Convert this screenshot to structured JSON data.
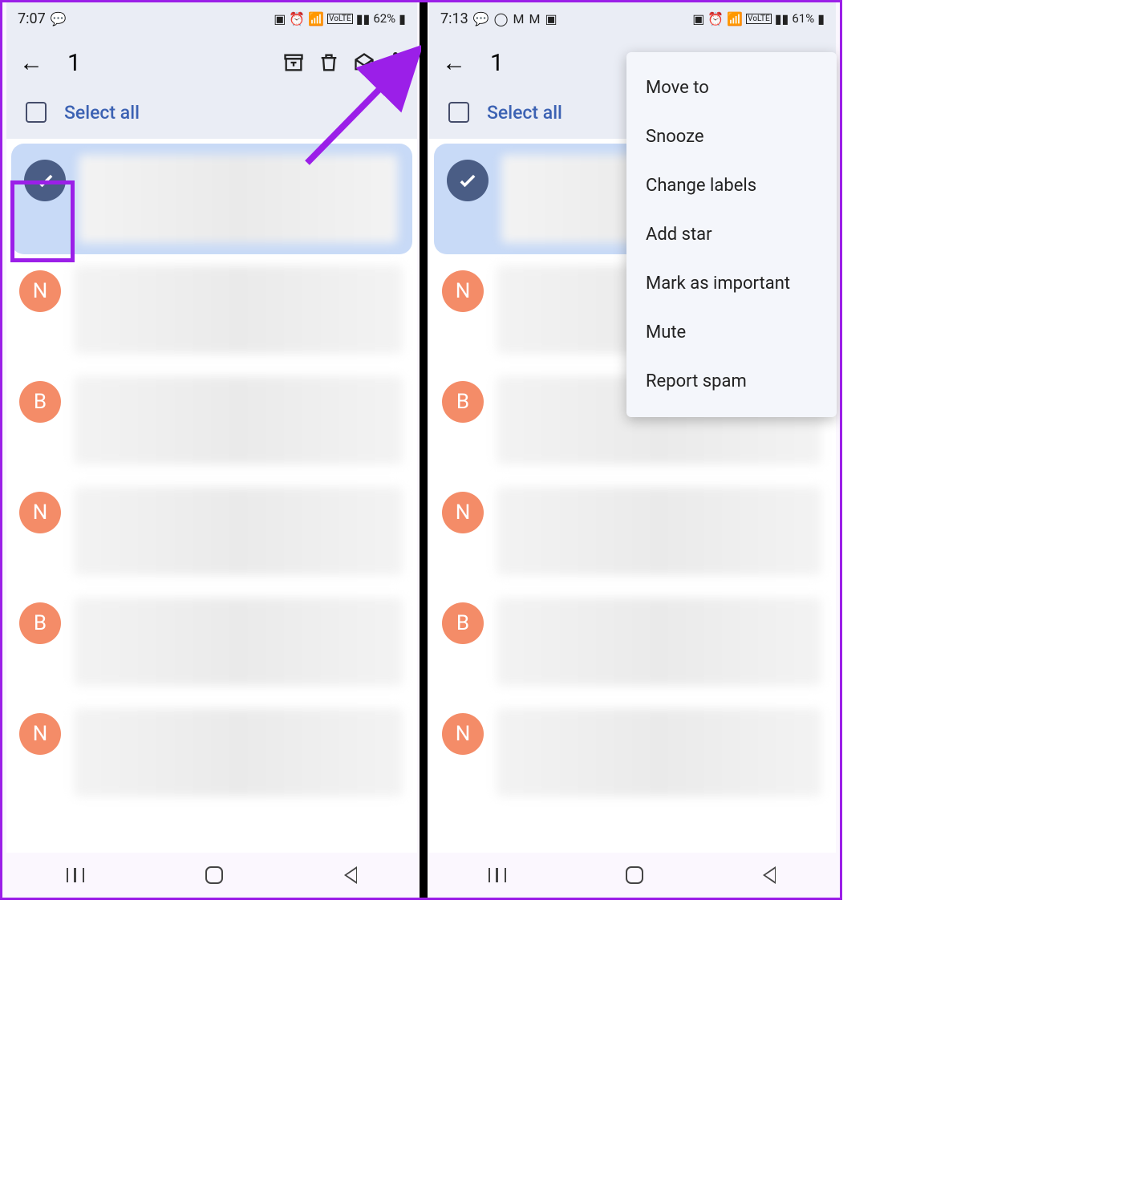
{
  "left": {
    "status": {
      "time": "7:07",
      "battery": "62%",
      "icons": "🗩 ⏰ 📶 📶"
    },
    "topbar": {
      "count": "1"
    },
    "select_all": "Select all",
    "rows": [
      {
        "type": "check",
        "letter": "✓"
      },
      {
        "type": "orange",
        "letter": "N"
      },
      {
        "type": "orange",
        "letter": "B"
      },
      {
        "type": "orange",
        "letter": "N"
      },
      {
        "type": "orange",
        "letter": "B"
      },
      {
        "type": "orange",
        "letter": "N"
      }
    ]
  },
  "right": {
    "status": {
      "time": "7:13",
      "battery": "61%",
      "icons": "🗩 ⏰ 📶 📶"
    },
    "topbar": {
      "count": "1"
    },
    "select_all": "Select all",
    "rows": [
      {
        "type": "check",
        "letter": "✓"
      },
      {
        "type": "orange",
        "letter": "N"
      },
      {
        "type": "orange",
        "letter": "B"
      },
      {
        "type": "orange",
        "letter": "N"
      },
      {
        "type": "orange",
        "letter": "B"
      },
      {
        "type": "orange",
        "letter": "N"
      }
    ],
    "menu": {
      "items": [
        "Move to",
        "Snooze",
        "Change labels",
        "Add star",
        "Mark as important",
        "Mute",
        "Report spam"
      ]
    }
  },
  "colors": {
    "accent": "#9b1fe8",
    "orange": "#f48c68",
    "checkblue": "#4a5d85"
  }
}
